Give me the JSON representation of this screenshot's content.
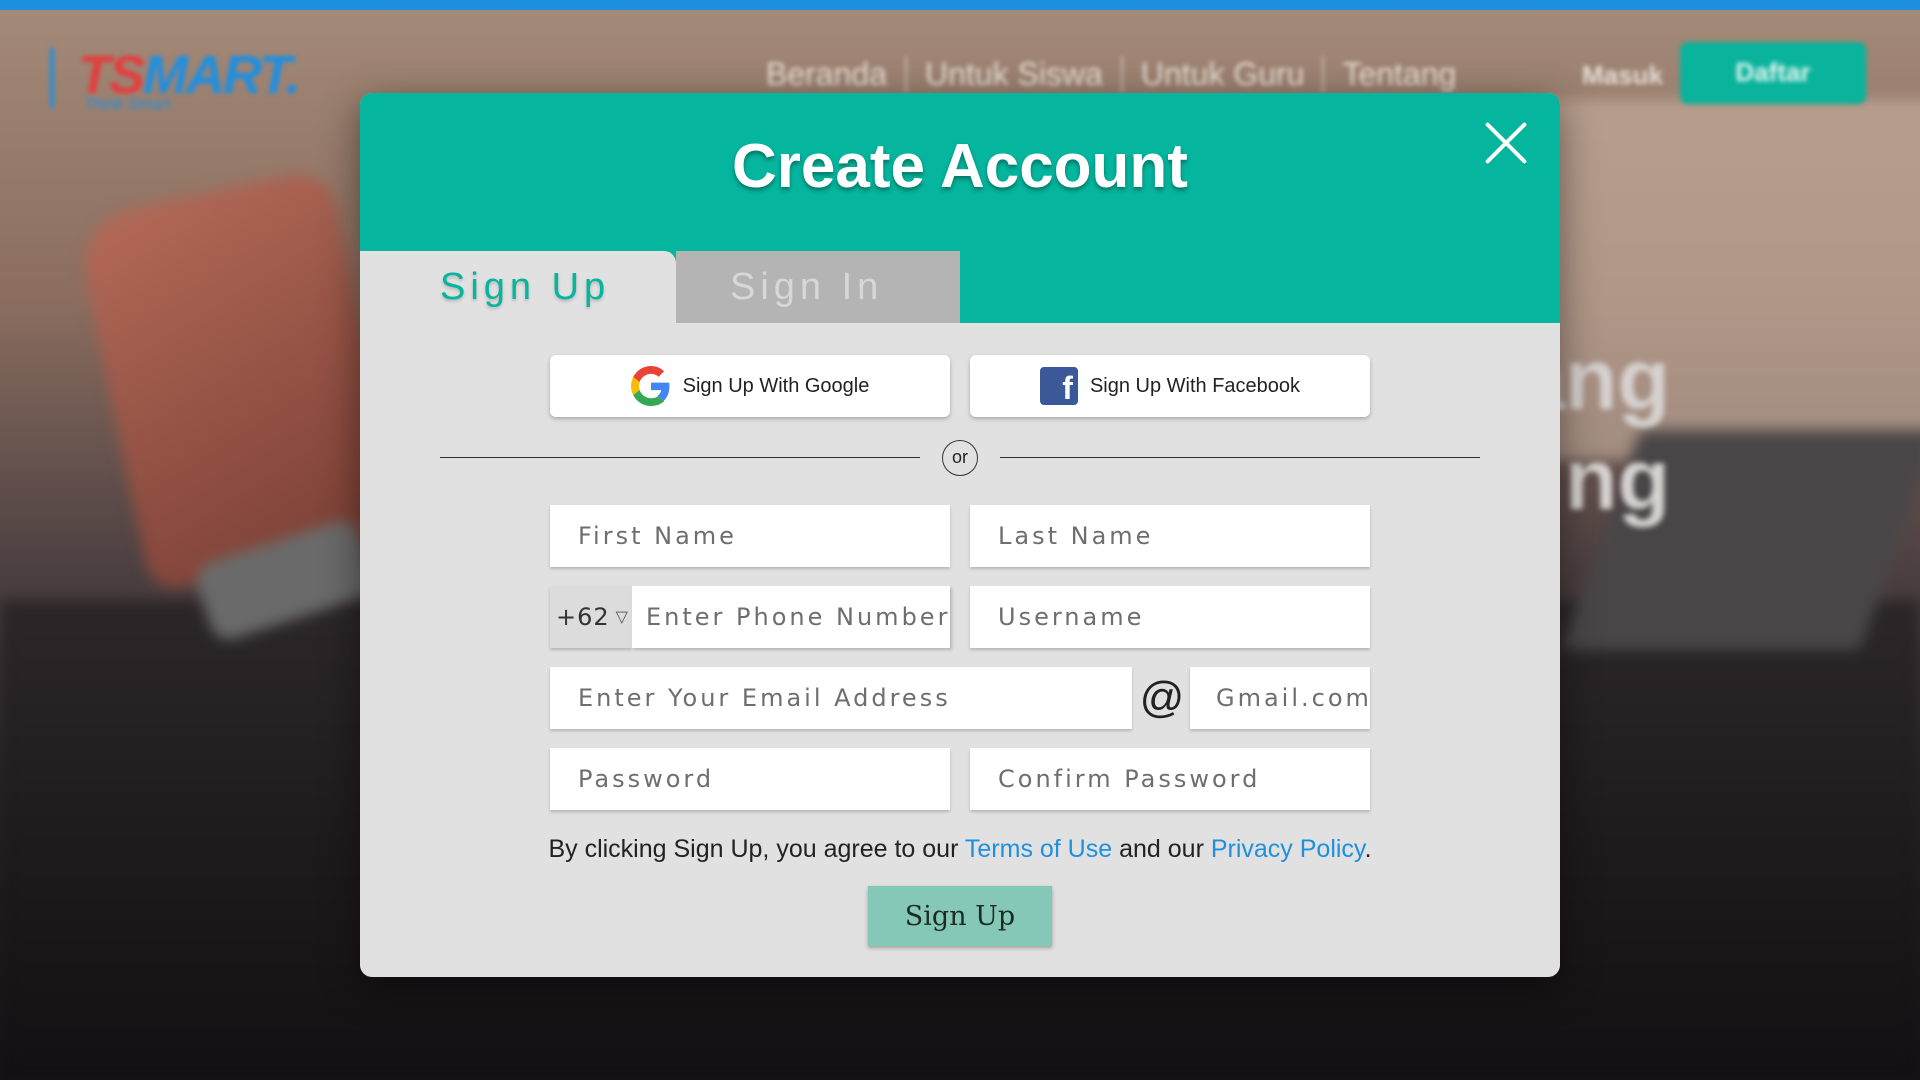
{
  "background": {
    "logo": {
      "brand_ts": "TS",
      "brand_smart": "MART.",
      "tagline": "Think Smart"
    },
    "nav": [
      "Beranda",
      "Untuk Siswa",
      "Untuk Guru",
      "Tentang"
    ],
    "login_label": "Masuk",
    "register_label": "Daftar",
    "hero_lines": [
      "ang",
      "ng"
    ]
  },
  "modal": {
    "title": "Create Account",
    "close_icon": "close-icon",
    "tabs": {
      "signup": "Sign Up",
      "signin": "Sign In",
      "active": "signup"
    },
    "social": {
      "google": "Sign Up With Google",
      "facebook": "Sign Up With Facebook"
    },
    "divider_label": "or",
    "fields": {
      "first_name": "First Name",
      "last_name": "Last Name",
      "country_code": "+62",
      "phone": "Enter Phone Number",
      "username": "Username",
      "email": "Enter Your Email Address",
      "at": "@",
      "email_domain": "Gmail.com",
      "password": "Password",
      "confirm_password": "Confirm Password"
    },
    "terms": {
      "prefix": "By clicking Sign Up, you agree to our ",
      "terms_link": "Terms of Use",
      "middle": " and our ",
      "privacy_link": "Privacy Policy",
      "suffix": "."
    },
    "submit_label": "Sign Up"
  },
  "colors": {
    "accent": "#05b59d",
    "link": "#1f8fe0",
    "submit": "#86c8b7",
    "modal_bg": "#e1e1e1"
  }
}
